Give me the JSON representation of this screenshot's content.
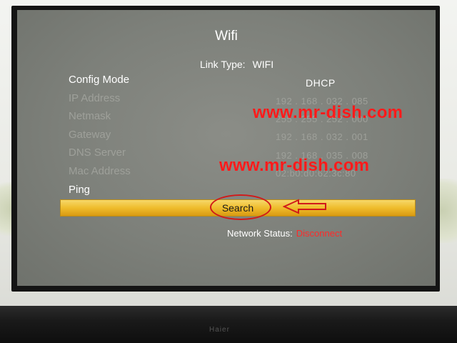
{
  "screen": {
    "title": "Wifi",
    "link_type_label": "Link Type:",
    "link_type_value": "WIFI",
    "rows": [
      {
        "label": "Config Mode",
        "value": "DHCP"
      },
      {
        "label": "IP Address",
        "value": "192 . 168 . 032 . 085"
      },
      {
        "label": "Netmask",
        "value": "255 . 255 . 252 . 000"
      },
      {
        "label": "Gateway",
        "value": "192 . 168 . 032 . 001"
      },
      {
        "label": "DNS Server",
        "value": "192 . 168 . 035 . 008"
      },
      {
        "label": "Mac Address",
        "value": "02:b0:d0:62:3c:80"
      },
      {
        "label": "Ping",
        "value": ""
      }
    ],
    "search_button": "Search",
    "network_status_label": "Network Status:",
    "network_status_value": "Disconnect"
  },
  "watermarks": [
    "www.mr-dish.com",
    "www.mr-dish.com"
  ],
  "tv_brand": "Haier",
  "colors": {
    "screen_bg": "#7d807a",
    "highlight_bar": "#efbc2c",
    "status_error": "#ff2a2a",
    "annotation": "#d11a1a"
  },
  "icons": [
    "arrow-left-annotation-icon",
    "circle-annotation"
  ]
}
